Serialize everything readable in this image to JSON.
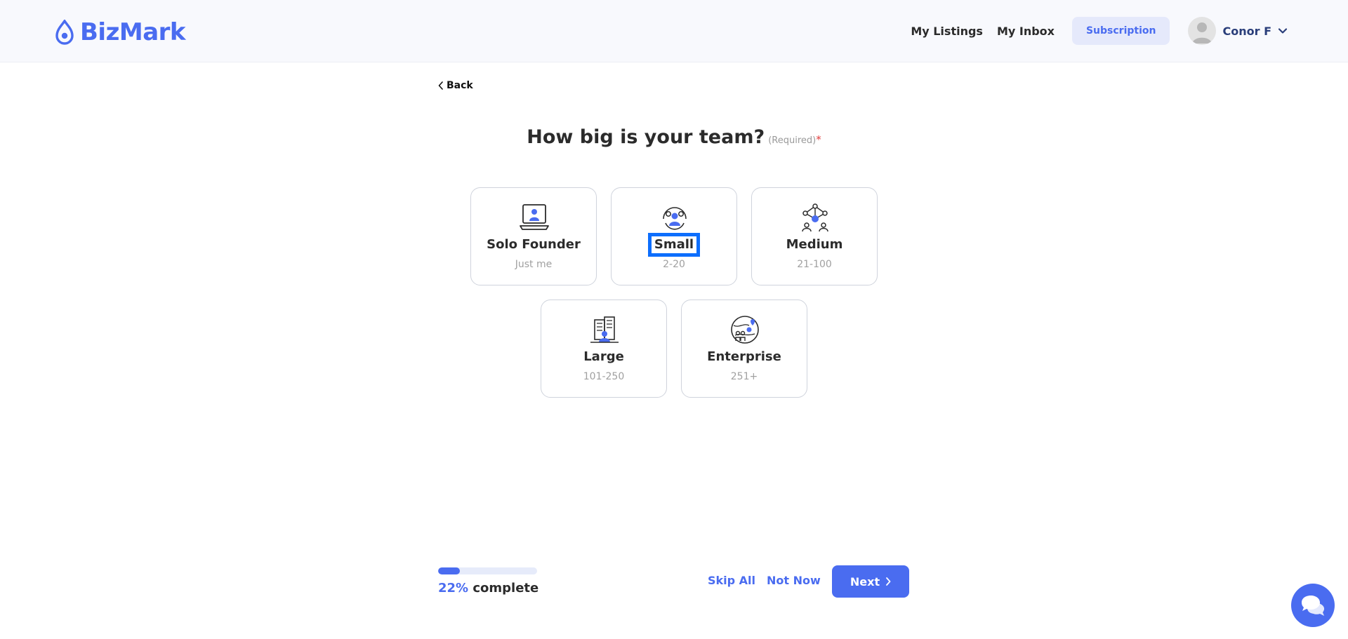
{
  "header": {
    "logo_text": "BizMark",
    "nav": {
      "listings": "My Listings",
      "inbox": "My Inbox"
    },
    "subscription_label": "Subscription",
    "user_name": "Conor F"
  },
  "back_label": "Back",
  "question": {
    "title": "How big is your team?",
    "required_note": "(Required)",
    "required_mark": "*"
  },
  "options": [
    {
      "label": "Solo Founder",
      "sub": "Just me",
      "icon": "laptop-person-icon"
    },
    {
      "label": "Small",
      "sub": "2-20",
      "icon": "small-team-icon"
    },
    {
      "label": "Medium",
      "sub": "21-100",
      "icon": "network-team-icon"
    },
    {
      "label": "Large",
      "sub": "101-250",
      "icon": "office-building-icon"
    },
    {
      "label": "Enterprise",
      "sub": "251+",
      "icon": "globe-people-icon"
    }
  ],
  "progress": {
    "percent_text": "22%",
    "suffix": " complete",
    "fraction": 0.22
  },
  "footer": {
    "skip_all": "Skip All",
    "not_now": "Not Now",
    "next": "Next"
  },
  "colors": {
    "accent": "#4a6cf0",
    "highlight": "#0d6efd",
    "required": "#e03b3b"
  }
}
